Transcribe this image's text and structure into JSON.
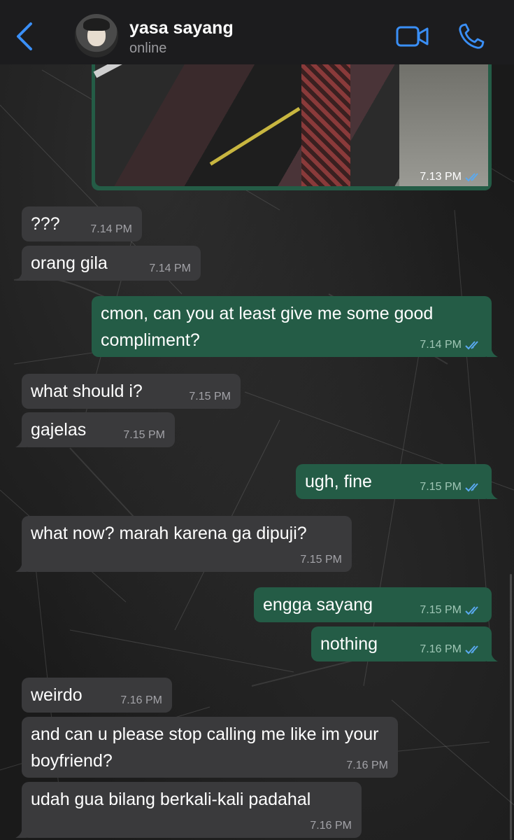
{
  "header": {
    "contact_name": "yasa sayang",
    "status": "online",
    "accent_color": "#3a8ff7"
  },
  "image_message": {
    "time": "7.13 PM",
    "read": true
  },
  "messages": [
    {
      "direction": "in",
      "text": "???",
      "time": "7.14 PM"
    },
    {
      "direction": "in",
      "text": "orang gila",
      "time": "7.14 PM"
    },
    {
      "direction": "out",
      "text": "cmon, can you at least give me some good compliment?",
      "time": "7.14 PM",
      "read": true
    },
    {
      "direction": "in",
      "text": "what should i?",
      "time": "7.15 PM"
    },
    {
      "direction": "in",
      "text": "gajelas",
      "time": "7.15 PM"
    },
    {
      "direction": "out",
      "text": "ugh, fine",
      "time": "7.15 PM",
      "read": true
    },
    {
      "direction": "in",
      "text": "what now? marah karena ga dipuji?",
      "time": "7.15 PM"
    },
    {
      "direction": "out",
      "text": "engga sayang",
      "time": "7.15 PM",
      "read": true
    },
    {
      "direction": "out",
      "text": "nothing",
      "time": "7.16 PM",
      "read": true
    },
    {
      "direction": "in",
      "text": "weirdo",
      "time": "7.16 PM"
    },
    {
      "direction": "in",
      "text": "and can u please stop calling me like im your boyfriend?",
      "time": "7.16 PM"
    },
    {
      "direction": "in",
      "text": "udah gua bilang berkali-kali padahal",
      "time": "7.16 PM"
    }
  ],
  "colors": {
    "incoming_bubble": "#3a3a3c",
    "outgoing_bubble": "#245c46",
    "read_tick": "#5aa9f0"
  }
}
